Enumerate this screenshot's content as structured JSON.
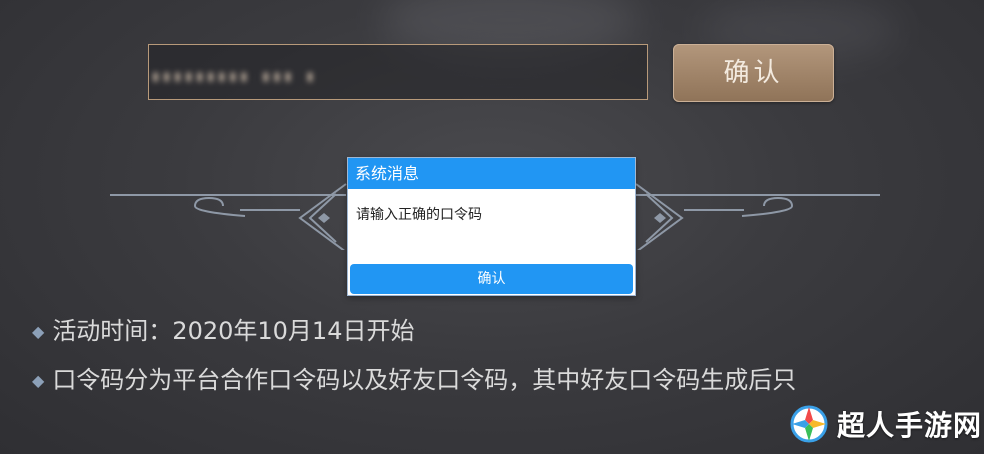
{
  "code_input": {
    "masked_value": "▮▮▮▮▮▮▮▮▮  ▮▮▮  ▮"
  },
  "confirm_button": {
    "label": "确认"
  },
  "dialog": {
    "title": "系统消息",
    "message": "请输入正确的口令码",
    "ok_label": "确认"
  },
  "info": {
    "line1": "活动时间：2020年10月14日开始",
    "line2": "口令码分为平台合作口令码以及好友口令码，其中好友口令码生成后只"
  },
  "watermark": {
    "text": "超人手游网"
  },
  "colors": {
    "dialog_blue": "#2196f3",
    "button_bronze": "#a58a6e",
    "frame_gold": "#b89a7a"
  }
}
